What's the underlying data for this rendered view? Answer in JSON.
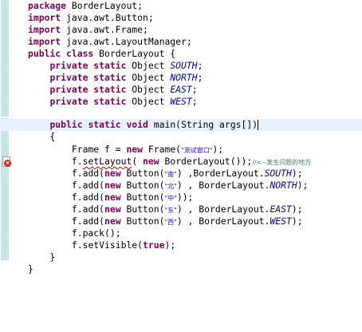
{
  "gutter": {
    "error_marker_glyph": "x",
    "quick_diff_color": "#b9dbe6"
  },
  "code": {
    "l1_kw": "package",
    "l1_rest": " BorderLayout;",
    "l2_kw": "import",
    "l2_rest": " java.awt.Button;",
    "l3_kw": "import",
    "l3_rest": " java.awt.Frame;",
    "l4_kw": "import",
    "l4_rest": " java.awt.LayoutManager;",
    "l5_kw": "public class",
    "l5_rest": " BorderLayout {",
    "l6_indent": "    ",
    "l6_kw": "private static",
    "l6_type": " Object ",
    "l6_field": "SOUTH",
    "l6_end": ";",
    "l7_indent": "    ",
    "l7_kw": "private static",
    "l7_type": " Object ",
    "l7_field": "NORTH",
    "l7_end": ";",
    "l8_indent": "    ",
    "l8_kw": "private static",
    "l8_type": " Object ",
    "l8_field": "EAST",
    "l8_end": ";",
    "l9_indent": "    ",
    "l9_kw": "private static",
    "l9_type": " Object ",
    "l9_field": "WEST",
    "l9_end": ";",
    "l11_indent": "    ",
    "l11_kw": "public static void",
    "l11_rest": " main(String args[])",
    "l12_text": "    {",
    "l13_indent": "        ",
    "l13_a": "Frame f = ",
    "l13_kw": "new",
    "l13_b": " Frame(",
    "l13_str": "\"测试窗口\"",
    "l13_end": ");",
    "l14_indent": "        ",
    "l14_a": "f.",
    "l14_err": "setLayout",
    "l14_b": "( ",
    "l14_kw": "new",
    "l14_c": " BorderLayout());",
    "l14_cmt": "//<--发生问题的地方",
    "l15_indent": "        ",
    "l15_a": "f.add(",
    "l15_kw": "new",
    "l15_b": " Button(",
    "l15_str": "\"南\"",
    "l15_c": ") ,BorderLayout.",
    "l15_field": "SOUTH",
    "l15_end": ");",
    "l16_indent": "        ",
    "l16_a": "f.add(",
    "l16_kw": "new",
    "l16_b": " Button(",
    "l16_str": "\"北\"",
    "l16_c": ") , BorderLayout.",
    "l16_field": "NORTH",
    "l16_end": ");",
    "l17_indent": "        ",
    "l17_a": "f.add(",
    "l17_kw": "new",
    "l17_b": " Button(",
    "l17_str": "\"中\"",
    "l17_end": "));",
    "l18_indent": "        ",
    "l18_a": "f.add(",
    "l18_kw": "new",
    "l18_b": " Button(",
    "l18_str": "\"东\"",
    "l18_c": ") , BorderLayout.",
    "l18_field": "EAST",
    "l18_end": ");",
    "l19_indent": "        ",
    "l19_a": "f.add(",
    "l19_kw": "new",
    "l19_b": " Button(",
    "l19_str": "\"西\"",
    "l19_c": ") , BorderLayout.",
    "l19_field": "WEST",
    "l19_end": ");",
    "l20_text": "        f.pack();",
    "l21_indent": "        ",
    "l21_a": "f.setVisible(",
    "l21_kw": "true",
    "l21_end": ");",
    "l22_text": "    }",
    "l23_text": "}"
  }
}
